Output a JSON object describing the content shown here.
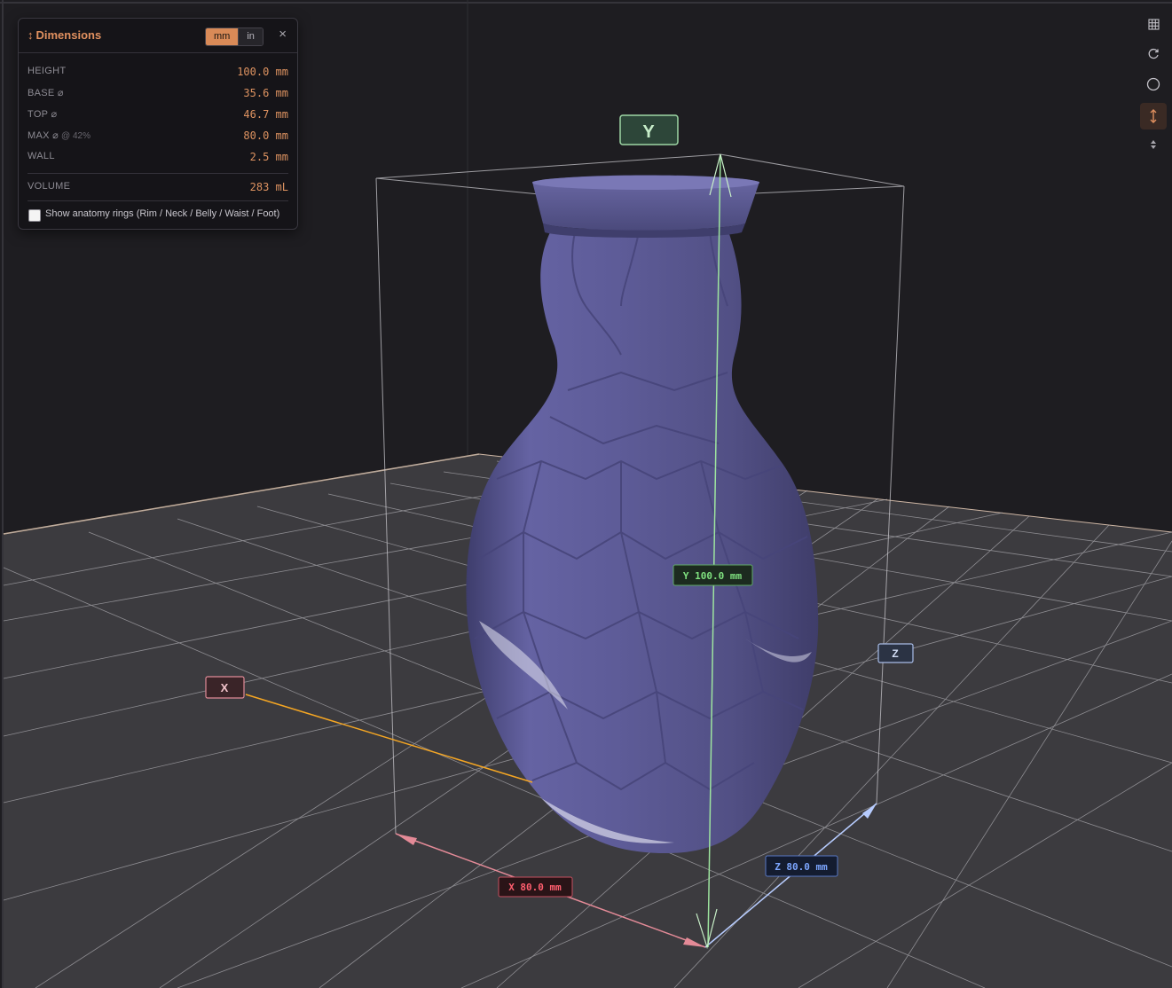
{
  "panel": {
    "title_icon": "↕",
    "title": "Dimensions",
    "unit_options": [
      "mm",
      "in"
    ],
    "unit_selected": "mm",
    "close": "×",
    "rows": [
      {
        "label": "HEIGHT",
        "value": "100.0 mm"
      },
      {
        "label": "BASE ⌀",
        "value": "35.6 mm"
      },
      {
        "label": "TOP ⌀",
        "value": "46.7 mm"
      },
      {
        "label": "MAX ⌀",
        "note": "@ 42%",
        "value": "80.0 mm"
      },
      {
        "label": "WALL",
        "value": "2.5 mm"
      }
    ],
    "volume": {
      "label": "VOLUME",
      "value": "283 mL"
    },
    "anatomy_checkbox": {
      "label": "Show anatomy rings (Rim / Neck / Belly / Waist / Foot)",
      "checked": false
    }
  },
  "toolbar": {
    "items": [
      {
        "name": "grid-icon",
        "active": false
      },
      {
        "name": "rotate-icon",
        "active": false
      },
      {
        "name": "circle-icon",
        "active": false
      },
      {
        "name": "dimensions-icon",
        "active": true
      },
      {
        "name": "diamond-icon",
        "active": false
      }
    ]
  },
  "viewport": {
    "axis_labels": {
      "x": "X",
      "y": "Y",
      "z": "Z"
    },
    "measurements": {
      "x": "X 80.0 mm",
      "y": "Y 100.0 mm",
      "z": "Z 80.0 mm"
    },
    "colors": {
      "background": "#1e1d21",
      "floor": "#3c3b3f",
      "grid": "#b7b6bb",
      "vase": "#5c5a94",
      "x_axis": "#e06c79",
      "x_line": "#f5a623",
      "y_axis": "#86e08a",
      "z_axis": "#7fa8ff"
    }
  }
}
